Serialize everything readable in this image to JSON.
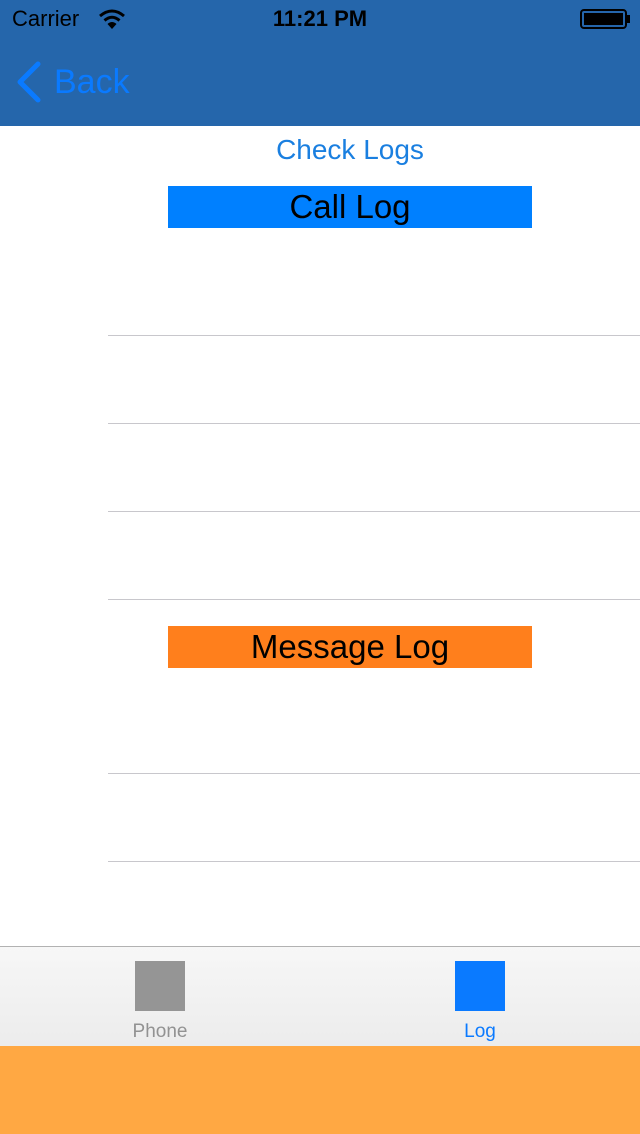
{
  "status_bar": {
    "carrier": "Carrier",
    "time": "11:21 PM",
    "wifi_icon": "wifi-icon",
    "battery_icon": "battery-icon"
  },
  "nav": {
    "back_label": "Back",
    "back_icon": "chevron-left-icon",
    "bar_color": "#2566ab"
  },
  "main": {
    "title": "Check Logs",
    "call_log_header": "Call Log",
    "call_log_color": "#0080ff",
    "message_log_header": "Message Log",
    "message_log_color": "#ff7f1c"
  },
  "tab_bar": {
    "tabs": [
      {
        "label": "Phone",
        "selected": false,
        "icon_color": "#959595"
      },
      {
        "label": "Log",
        "selected": true,
        "icon_color": "#0a7aff"
      }
    ]
  },
  "bottom_strip_color": "#ffa843"
}
